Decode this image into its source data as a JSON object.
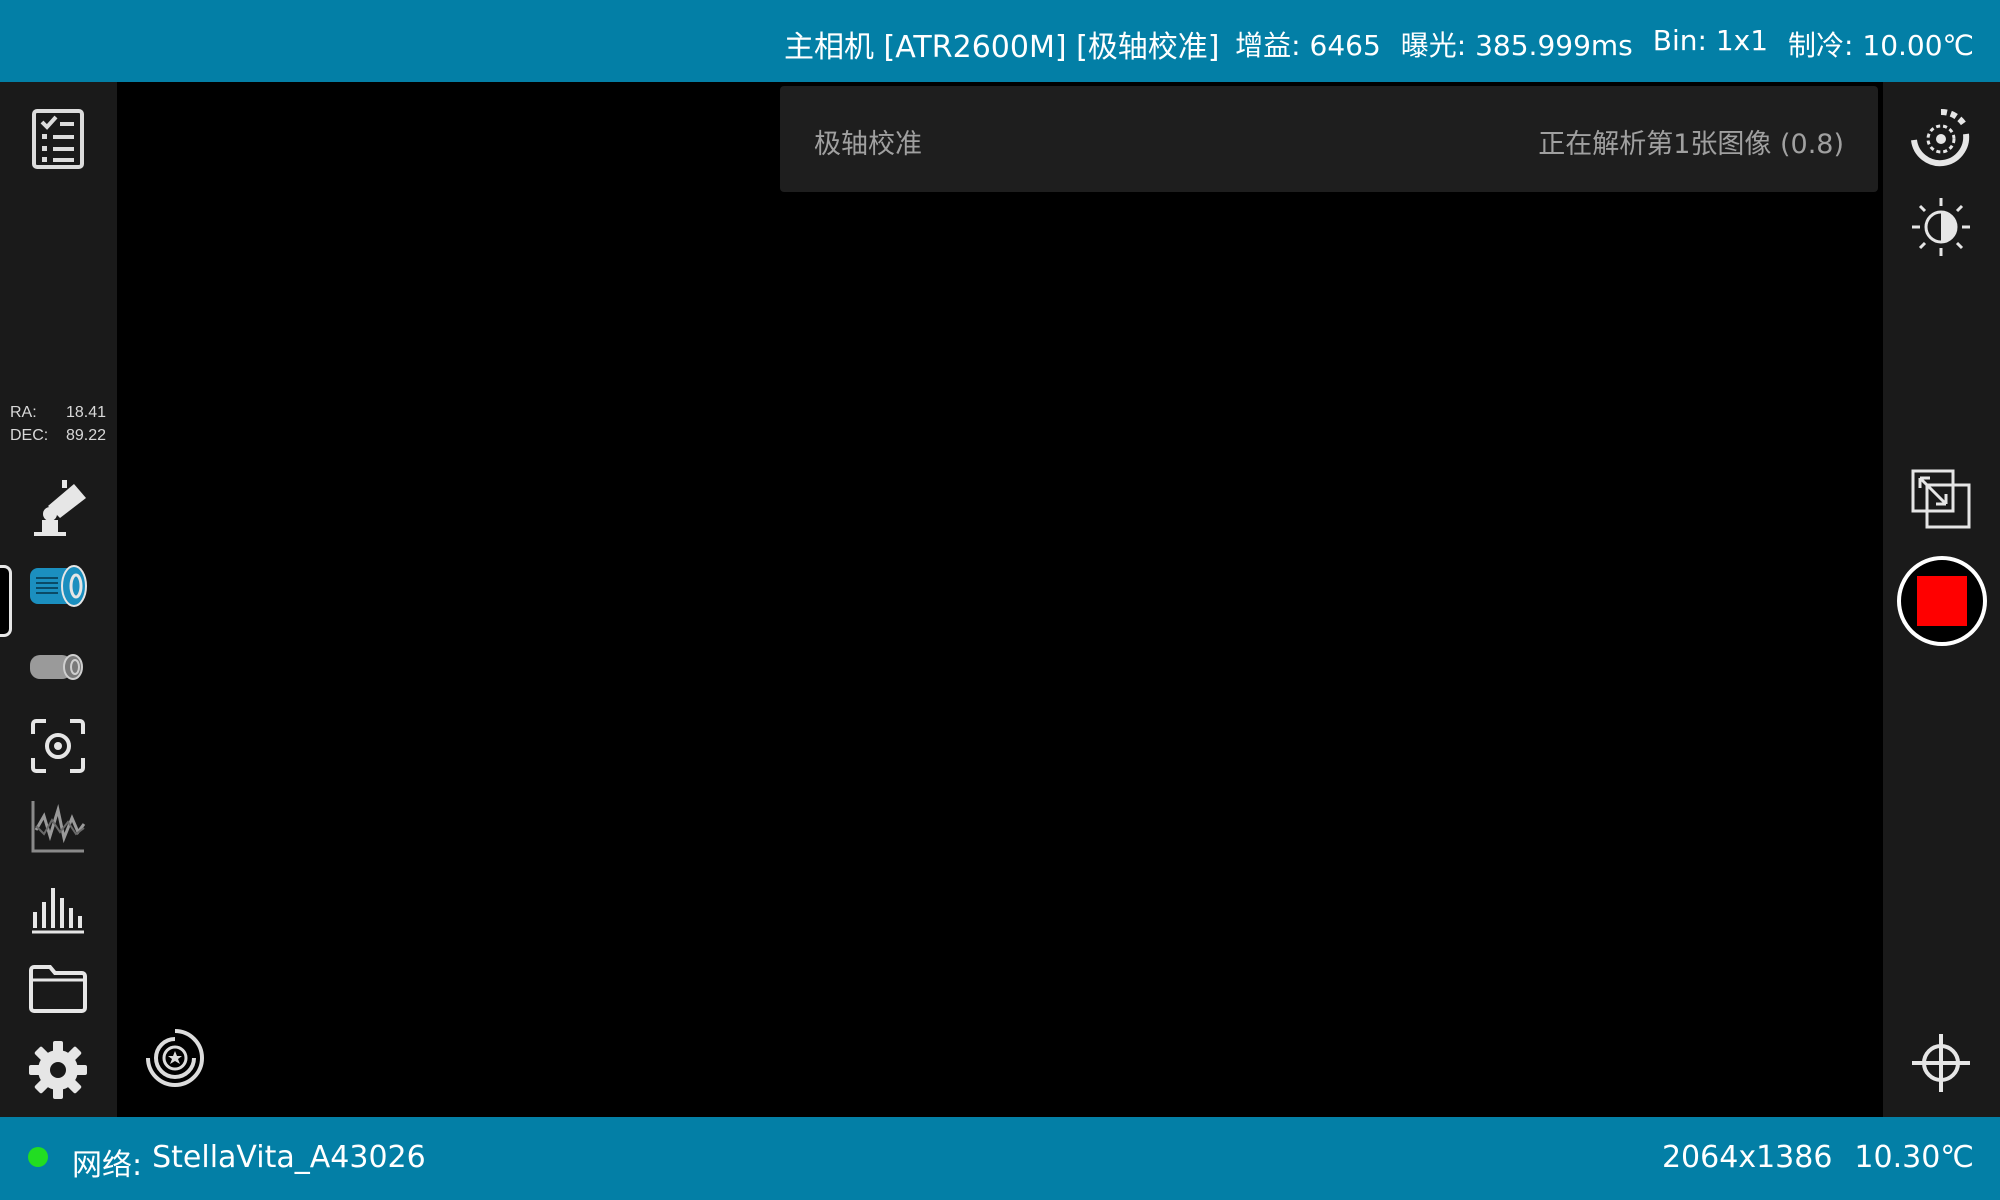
{
  "header": {
    "camera_title": "主相机 [ATR2600M] [极轴校准]",
    "gain": "增益: 6465",
    "exposure": "曝光: 385.999ms",
    "bin": "Bin: 1x1",
    "cooling": "制冷: 10.00℃"
  },
  "notice": {
    "title": "极轴校准",
    "status": "正在解析第1张图像 (0.8)"
  },
  "coords": {
    "ra_label": "RA:",
    "ra_value": "18.41",
    "dec_label": "DEC:",
    "dec_value": "89.22"
  },
  "left_toolbar": [
    "checklist-icon",
    "mount-icon",
    "main-camera-icon",
    "guide-camera-icon",
    "focus-icon",
    "guide-graph-icon",
    "histogram-icon",
    "folder-icon",
    "settings-icon"
  ],
  "right_toolbar": [
    "autostretch-icon",
    "brightness-icon",
    "crop-icon",
    "stop-record-button",
    "crosshair-icon"
  ],
  "footer": {
    "network_label": "网络:",
    "network_name": "StellaVita_A43026",
    "resolution": "2064x1386",
    "temperature": "10.30℃"
  },
  "colors": {
    "accent_bar": "#037fa6",
    "panel": "#1a1a1a",
    "stop_red": "#ff0000",
    "status_green": "#22dd22",
    "camera_active": "#1b8fbf"
  }
}
